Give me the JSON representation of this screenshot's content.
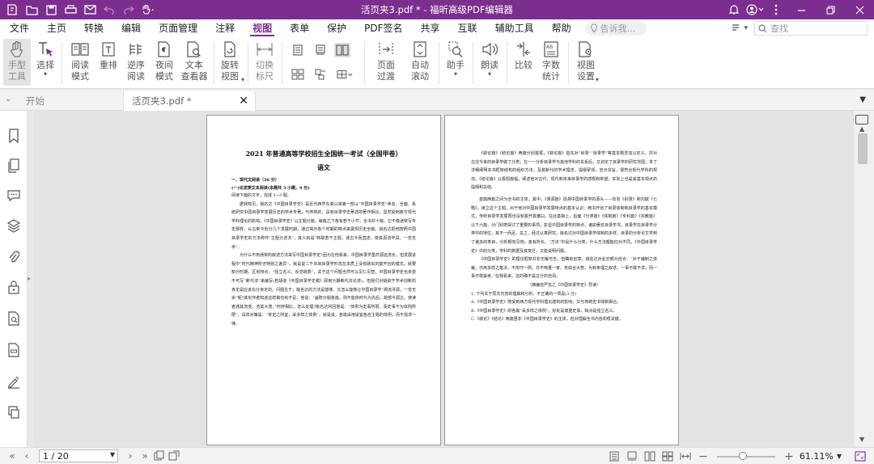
{
  "window": {
    "title": "活页夹3.pdf * - 福昕高级PDF编辑器",
    "accent": "#7c2e8f"
  },
  "quick_access": [
    "new-file-icon",
    "open-folder-icon",
    "print-icon",
    "save-icon",
    "email-icon",
    "undo-icon",
    "redo-icon",
    "hand-tool-icon"
  ],
  "menu": {
    "items": [
      "文件",
      "主页",
      "转换",
      "编辑",
      "页面管理",
      "注释",
      "视图",
      "表单",
      "保护",
      "PDF签名",
      "共享",
      "互联",
      "辅助工具",
      "帮助"
    ],
    "active": "视图",
    "tell_me": "告诉我...",
    "search_placeholder": "查找"
  },
  "ribbon": {
    "hand_tool": "手型\n工具",
    "select": "选择",
    "read_mode": "阅读\n模式",
    "reflow": "重排",
    "reverse_read": "逆序\n阅读",
    "night_mode": "夜间\n模式",
    "text_viewer": "文本\n查看器",
    "rotate_view": "旋转\n视图",
    "toggle_ruler": "切换\n标尺",
    "page_transition": "页面\n过渡",
    "auto_scroll": "自动\n滚动",
    "assistant": "助手",
    "read_aloud": "朗读",
    "compare": "比较",
    "word_count": "字数\n统计",
    "view_settings": "视图\n设置"
  },
  "tabs": {
    "home": "开始",
    "doc": "活页夹3.pdf *"
  },
  "document": {
    "title": "2021 年普通高等学校招生全国统一考试（全国甲卷）",
    "subject": "语文",
    "sec1": "一、现代文阅读（36 分）",
    "sec1a": "(一)论述类文本阅读(本题共 3 小题，9 分)",
    "instruction": "阅读下面的文字，完成 1~3 题。",
    "p1": "据我知见，姚名达《中国目录学史》是近代西学东渐以来第一部以“中国目录学史”命名，全面、系统研究中国目录学发展历史的学术专著。与传统的、具有目录学史著述的著作相比，显然受到西方现代学科理论的影响，《中国目录学史》以主题分篇，每篇之下各有若干小节，全书共十篇。它不像通常写专史那样，从古到今划分几个发展时期，通过揭示各个时期的特点来展现历史全貌。姚名达把他按照中国目录学史的方法称作“主题分述法”，其义就是“特取若干主题，通古今而直述，使其源流毕具，一览无余”。",
    "p2": "为什么不用通常的叙述方法来写中国目录学史?因为在他看来，中国目录学虽然源远流长，但发展进程中“时代精神所无特别之差异”，就是说二千年来目录学形态在本质上没有跳出刘歆开创的模式，就要知分时期，区划特点。“强立名义，反觉辞费”，关于这个问题当然可以见仁见智，中国目录学史也未尝不可写“断代法”来编写(若胡道《中国目录学史稿》即用分期断代法论述)，但我们对姚欲于学术创新的肯定是应该充分肯定的。问题在于，姚名达的方法是能够、又怎么能够让中国目录学“溯流寻源，一览无余”呢?其实作者知道这样做也有不足，他说：“盖既分题各篇，则不能依时代为先后，故部今源古，使读者通其流变，览其大意。”何辨相比，怎么处理?姚名达的回答是：“体例为史事所限，而史事不为体例所限”，具体对策是：“依史之所宜，采多样之体例”，就是说，各篇采用适宜各自主题的体例，而不强求一律。",
    "p3": "《叙论篇》《结论篇》两篇分别首尾，《叙论篇》首先对“目录”“目录学”等基本概念加以定义，并对古往今来的目录学做了分类；在一一分析目录学与其他学科的关系后，又划定了目录学的研究范围；末了详细阐明本书框架结构的组织方法，及其断代的学术理念、提纲挈领，宣示宗旨，很符合现代学科的规范。《结论篇》以极短篇幅，阐述他对古代、现代和未来目录学的感慨和希望；实际上也是其基本观点的提纲和总结。",
    "p4": "首篇两篇之间为全书的主体，其中，《溯源篇》追溯中国目录学的源头——向向《别录》和刘歆《七略》，读立这个主题，出于他对中国目录学发展特点的基本认识：两书开创了目录体制和目录学的基本模式，传统目录学发展再也没有脱开其窠臼。在此基础上，后面《分类篇》《体制篇》《专科篇》《宗教篇》以下六篇，分门别类探讨了重要的事项，彰显中国目录学的特点，诸如著名目录学书，目录学在目录学分类中的地位，其不一而足。总之，经过认真研究，姚名达对中国目录学体制的多样，目录的分析论文学到了诸多的类目，分析颇有见地，各有所长。“方法”中是什么分类，什么方法都能应对不同，《中国目录学史》中的分类，学科的数据及其变迁，又能说明问题。",
    "p5": "《中国目录学史》的理论框架并非无懈可击，但确有创意，姚名达对此亦颇为自许：“对于编制之体裁，亦用多样之笔法，不拘守一例，亦不特重一家。务综合大势，为有条理之叙述，一事不敢不详，而一事不敢妄考。”在我看来，这的确不是过分的自诩。",
    "source": "（摘编自严佐之《中国目录学史》导读）",
    "q1": "1. 下列关于原文内容的理解和分析，不正确的一项是(3 分)",
    "qa": "A.《中国目录学史》既受到西方现代学科理论建构的影响，又与传统史书体制相合。",
    "qb": "B.《中国目录学史》的各篇“采多样之体例”，好处是尊重史事，缺点是强立名义。",
    "qc": "C.《叙论》《结论》两篇虽非《中国目录学史》的主体，但对理解全书内容却很关键。"
  },
  "status": {
    "page": "1 / 20",
    "zoom": "61.11%",
    "zoom_fraction": 0.44
  }
}
